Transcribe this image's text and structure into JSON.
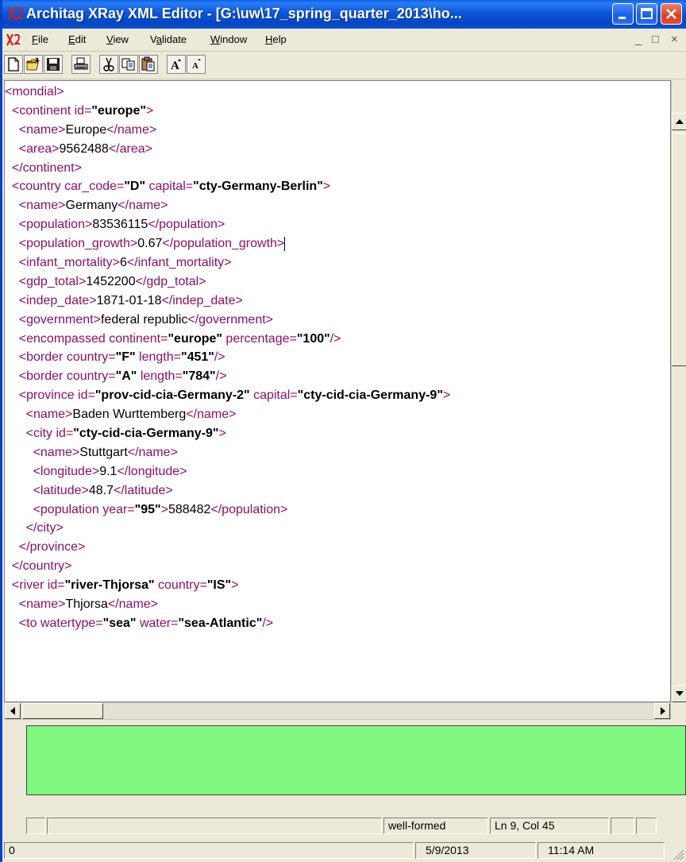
{
  "window": {
    "title": "Architag XRay XML Editor - [G:\\uw\\17_spring_quarter_2013\\ho...",
    "app_icon": "xray-logo-icon"
  },
  "menu": {
    "items": [
      "File",
      "Edit",
      "View",
      "Validate",
      "Window",
      "Help"
    ],
    "mdi_controls": [
      "_",
      "□",
      "×"
    ]
  },
  "toolbar": {
    "buttons": [
      "new-document-icon",
      "open-folder-icon",
      "save-icon",
      "print-icon",
      "cut-icon",
      "copy-icon",
      "paste-icon",
      "font-larger-icon",
      "font-smaller-icon"
    ]
  },
  "editor": {
    "lines": [
      [
        {
          "t": "tg",
          "v": "<mondial>"
        }
      ],
      [
        {
          "t": "tx",
          "v": "  "
        },
        {
          "t": "tg",
          "v": "<continent "
        },
        {
          "t": "an",
          "v": "id="
        },
        {
          "t": "av",
          "v": "\"europe\""
        },
        {
          "t": "tg",
          "v": ">"
        }
      ],
      [
        {
          "t": "tx",
          "v": "    "
        },
        {
          "t": "tg",
          "v": "<name>"
        },
        {
          "t": "tx",
          "v": "Europe"
        },
        {
          "t": "tg",
          "v": "</name>"
        }
      ],
      [
        {
          "t": "tx",
          "v": "    "
        },
        {
          "t": "tg",
          "v": "<area>"
        },
        {
          "t": "tx",
          "v": "9562488"
        },
        {
          "t": "tg",
          "v": "</area>"
        }
      ],
      [
        {
          "t": "tx",
          "v": "  "
        },
        {
          "t": "tg",
          "v": "</continent>"
        }
      ],
      [
        {
          "t": "tx",
          "v": "  "
        },
        {
          "t": "tg",
          "v": "<country "
        },
        {
          "t": "an",
          "v": "car_code="
        },
        {
          "t": "av",
          "v": "\"D\""
        },
        {
          "t": "an",
          "v": " capital="
        },
        {
          "t": "av",
          "v": "\"cty-Germany-Berlin\""
        },
        {
          "t": "tg",
          "v": ">"
        }
      ],
      [
        {
          "t": "tx",
          "v": "    "
        },
        {
          "t": "tg",
          "v": "<name>"
        },
        {
          "t": "tx",
          "v": "Germany"
        },
        {
          "t": "tg",
          "v": "</name>"
        }
      ],
      [
        {
          "t": "tx",
          "v": "    "
        },
        {
          "t": "tg",
          "v": "<population>"
        },
        {
          "t": "tx",
          "v": "83536115"
        },
        {
          "t": "tg",
          "v": "</population>"
        }
      ],
      [
        {
          "t": "tx",
          "v": "    "
        },
        {
          "t": "tg",
          "v": "<population_growth>"
        },
        {
          "t": "tx",
          "v": "0.67"
        },
        {
          "t": "tg",
          "v": "</population_growth>"
        },
        {
          "t": "caret",
          "v": ""
        }
      ],
      [
        {
          "t": "tx",
          "v": "    "
        },
        {
          "t": "tg",
          "v": "<infant_mortality>"
        },
        {
          "t": "tx",
          "v": "6"
        },
        {
          "t": "tg",
          "v": "</infant_mortality>"
        }
      ],
      [
        {
          "t": "tx",
          "v": "    "
        },
        {
          "t": "tg",
          "v": "<gdp_total>"
        },
        {
          "t": "tx",
          "v": "1452200"
        },
        {
          "t": "tg",
          "v": "</gdp_total>"
        }
      ],
      [
        {
          "t": "tx",
          "v": "    "
        },
        {
          "t": "tg",
          "v": "<indep_date>"
        },
        {
          "t": "tx",
          "v": "1871-01-18"
        },
        {
          "t": "tg",
          "v": "</indep_date>"
        }
      ],
      [
        {
          "t": "tx",
          "v": "    "
        },
        {
          "t": "tg",
          "v": "<government>"
        },
        {
          "t": "tx",
          "v": "federal republic"
        },
        {
          "t": "tg",
          "v": "</government>"
        }
      ],
      [
        {
          "t": "tx",
          "v": "    "
        },
        {
          "t": "tg",
          "v": "<encompassed "
        },
        {
          "t": "an",
          "v": "continent="
        },
        {
          "t": "av",
          "v": "\"europe\""
        },
        {
          "t": "an",
          "v": " percentage="
        },
        {
          "t": "av",
          "v": "\"100\""
        },
        {
          "t": "tg",
          "v": "/>"
        }
      ],
      [
        {
          "t": "tx",
          "v": "    "
        },
        {
          "t": "tg",
          "v": "<border "
        },
        {
          "t": "an",
          "v": "country="
        },
        {
          "t": "av",
          "v": "\"F\""
        },
        {
          "t": "an",
          "v": " length="
        },
        {
          "t": "av",
          "v": "\"451\""
        },
        {
          "t": "tg",
          "v": "/>"
        }
      ],
      [
        {
          "t": "tx",
          "v": "    "
        },
        {
          "t": "tg",
          "v": "<border "
        },
        {
          "t": "an",
          "v": "country="
        },
        {
          "t": "av",
          "v": "\"A\""
        },
        {
          "t": "an",
          "v": " length="
        },
        {
          "t": "av",
          "v": "\"784\""
        },
        {
          "t": "tg",
          "v": "/>"
        }
      ],
      [
        {
          "t": "tx",
          "v": "    "
        },
        {
          "t": "tg",
          "v": "<province "
        },
        {
          "t": "an",
          "v": "id="
        },
        {
          "t": "av",
          "v": "\"prov-cid-cia-Germany-2\""
        },
        {
          "t": "an",
          "v": " capital="
        },
        {
          "t": "av",
          "v": "\"cty-cid-cia-Germany-9\""
        },
        {
          "t": "tg",
          "v": ">"
        }
      ],
      [
        {
          "t": "tx",
          "v": "      "
        },
        {
          "t": "tg",
          "v": "<name>"
        },
        {
          "t": "tx",
          "v": "Baden Wurttemberg"
        },
        {
          "t": "tg",
          "v": "</name>"
        }
      ],
      [
        {
          "t": "tx",
          "v": "      "
        },
        {
          "t": "tg",
          "v": "<city "
        },
        {
          "t": "an",
          "v": "id="
        },
        {
          "t": "av",
          "v": "\"cty-cid-cia-Germany-9\""
        },
        {
          "t": "tg",
          "v": ">"
        }
      ],
      [
        {
          "t": "tx",
          "v": "        "
        },
        {
          "t": "tg",
          "v": "<name>"
        },
        {
          "t": "tx",
          "v": "Stuttgart"
        },
        {
          "t": "tg",
          "v": "</name>"
        }
      ],
      [
        {
          "t": "tx",
          "v": "        "
        },
        {
          "t": "tg",
          "v": "<longitude>"
        },
        {
          "t": "tx",
          "v": "9.1"
        },
        {
          "t": "tg",
          "v": "</longitude>"
        }
      ],
      [
        {
          "t": "tx",
          "v": "        "
        },
        {
          "t": "tg",
          "v": "<latitude>"
        },
        {
          "t": "tx",
          "v": "48.7"
        },
        {
          "t": "tg",
          "v": "</latitude>"
        }
      ],
      [
        {
          "t": "tx",
          "v": "        "
        },
        {
          "t": "tg",
          "v": "<population "
        },
        {
          "t": "an",
          "v": "year="
        },
        {
          "t": "av",
          "v": "\"95\""
        },
        {
          "t": "tg",
          "v": ">"
        },
        {
          "t": "tx",
          "v": "588482"
        },
        {
          "t": "tg",
          "v": "</population>"
        }
      ],
      [
        {
          "t": "tx",
          "v": "      "
        },
        {
          "t": "tg",
          "v": "</city>"
        }
      ],
      [
        {
          "t": "tx",
          "v": "    "
        },
        {
          "t": "tg",
          "v": "</province>"
        }
      ],
      [
        {
          "t": "tx",
          "v": "  "
        },
        {
          "t": "tg",
          "v": "</country>"
        }
      ],
      [
        {
          "t": "tx",
          "v": "  "
        },
        {
          "t": "tg",
          "v": "<river "
        },
        {
          "t": "an",
          "v": "id="
        },
        {
          "t": "av",
          "v": "\"river-Thjorsa\""
        },
        {
          "t": "an",
          "v": " country="
        },
        {
          "t": "av",
          "v": "\"IS\""
        },
        {
          "t": "tg",
          "v": ">"
        }
      ],
      [
        {
          "t": "tx",
          "v": "    "
        },
        {
          "t": "tg",
          "v": "<name>"
        },
        {
          "t": "tx",
          "v": "Thjorsa"
        },
        {
          "t": "tg",
          "v": "</name>"
        }
      ],
      [
        {
          "t": "tx",
          "v": "    "
        },
        {
          "t": "tg",
          "v": "<to "
        },
        {
          "t": "an",
          "v": "watertype="
        },
        {
          "t": "av",
          "v": "\"sea\""
        },
        {
          "t": "an",
          "v": " water="
        },
        {
          "t": "av",
          "v": "\"sea-Atlantic\""
        },
        {
          "t": "tg",
          "v": "/>"
        }
      ]
    ]
  },
  "message_pane": {
    "color": "#80f880",
    "text": ""
  },
  "status": {
    "validation": "well-formed",
    "cursor": "Ln 9, Col 45",
    "count": "0",
    "date": "5/9/2013",
    "time": "11:14 AM"
  },
  "colors": {
    "tag": "#8b0f65",
    "title_bar": "#0a5fe8"
  }
}
